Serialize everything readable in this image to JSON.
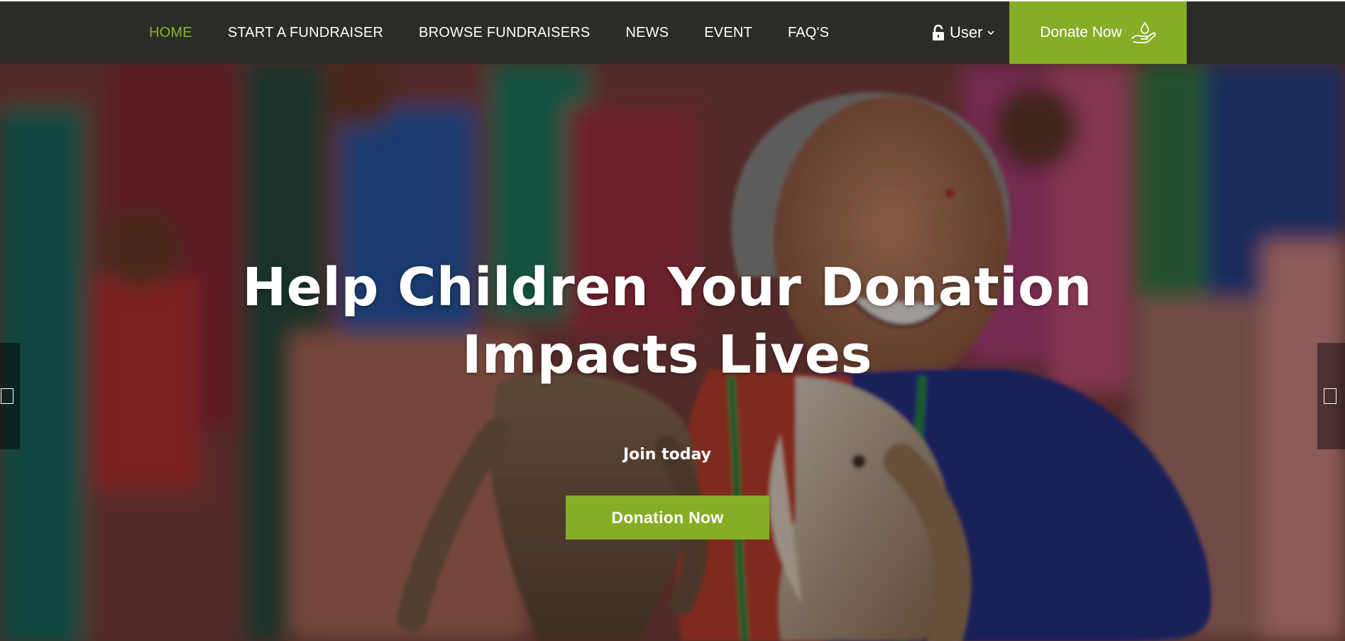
{
  "nav": {
    "items": [
      {
        "label": "HOME",
        "active": true
      },
      {
        "label": "START A FUNDRAISER",
        "active": false
      },
      {
        "label": "BROWSE FUNDRAISERS",
        "active": false
      },
      {
        "label": "NEWS",
        "active": false
      },
      {
        "label": "EVENT",
        "active": false
      },
      {
        "label": "FAQ'S",
        "active": false
      }
    ],
    "user_label": "User",
    "donate_label": "Donate Now"
  },
  "hero": {
    "title_line1": "Help Children Your Donation",
    "title_line2": "Impacts Lives",
    "subtitle": "Join today",
    "cta_label": "Donation Now"
  },
  "icons": {
    "lock": "unlock-icon",
    "chevron": "chevron-down-icon",
    "donate": "hand-drop-icon",
    "prev": "slider-prev-icon",
    "next": "slider-next-icon"
  },
  "colors": {
    "navbar_bg": "#2c2b27",
    "accent_green": "#85ad26",
    "active_link": "#8ab42a",
    "text": "#ffffff"
  }
}
